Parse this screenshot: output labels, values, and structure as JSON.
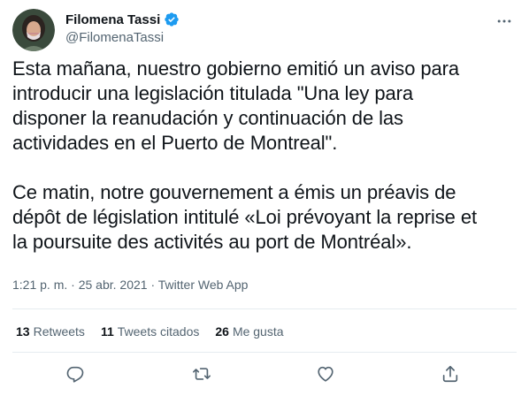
{
  "author": {
    "display_name": "Filomena Tassi",
    "handle": "@FilomenaTassi",
    "verified": true
  },
  "tweet": {
    "text_es": "Esta mañana, nuestro gobierno emitió un aviso para\nintroducir una legislación titulada \"Una ley para\ndisponer la reanudación y continuación de las\nactividades en el Puerto de Montreal\".",
    "text_fr": "Ce matin, notre gouvernement a émis un préavis de\ndépôt de législation intitulé «Loi prévoyant la reprise et\nla poursuite des activités au port de Montréal»."
  },
  "meta": {
    "time": "1:21 p. m.",
    "separator": " · ",
    "date": "25 abr. 2021",
    "source": "Twitter Web App"
  },
  "stats": {
    "retweets_count": "13",
    "retweets_label": "Retweets",
    "quotes_count": "11",
    "quotes_label": "Tweets citados",
    "likes_count": "26",
    "likes_label": "Me gusta"
  },
  "colors": {
    "text": "#0f1419",
    "secondary": "#536471",
    "verified": "#1d9bf0",
    "divider": "#e6ecf0"
  },
  "icons": [
    "verified-badge-icon",
    "more-icon",
    "reply-icon",
    "retweet-icon",
    "like-icon",
    "share-icon"
  ]
}
